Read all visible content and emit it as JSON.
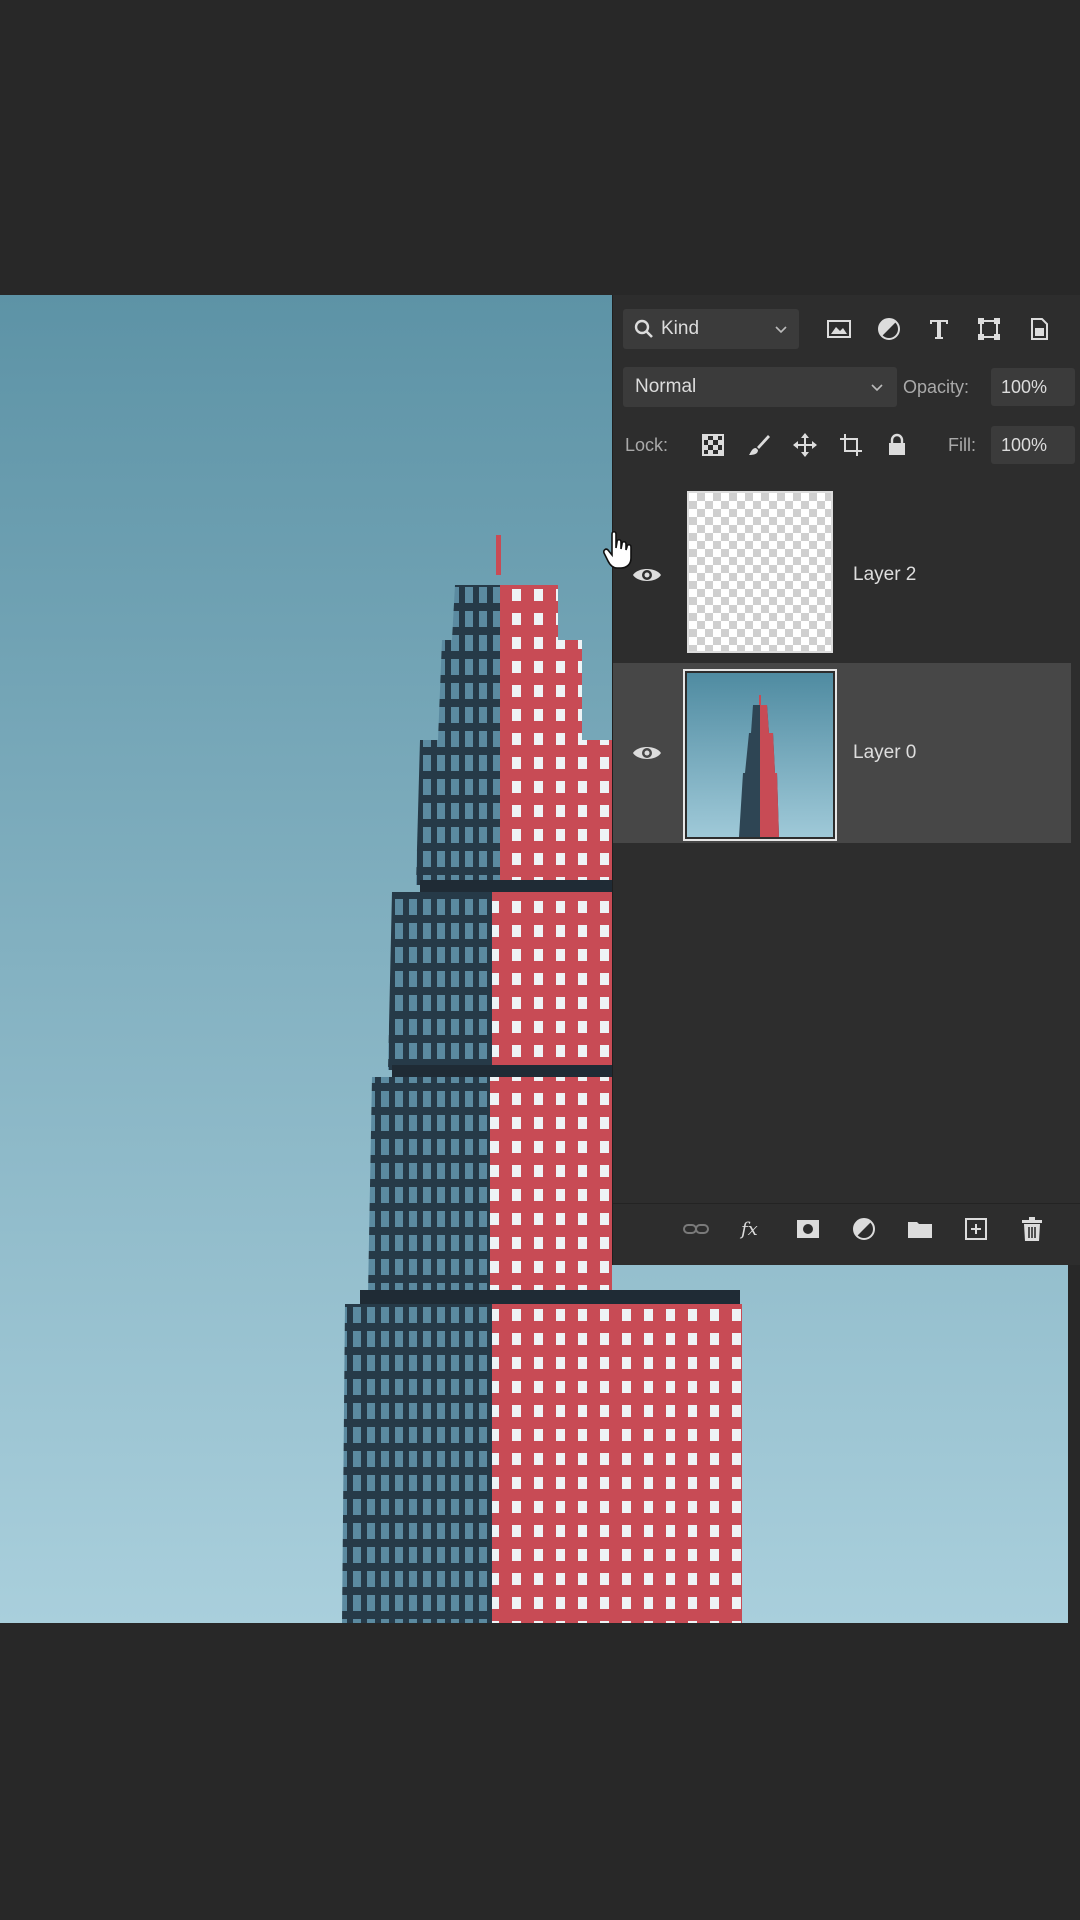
{
  "panel": {
    "filter": {
      "kind_label": "Kind",
      "icons": [
        "image-filter-icon",
        "adjustment-filter-icon",
        "type-filter-icon",
        "shape-filter-icon",
        "smart-object-filter-icon"
      ]
    },
    "blend": {
      "mode": "Normal",
      "opacity_label": "Opacity:",
      "opacity_value": "100%"
    },
    "lock": {
      "label": "Lock:",
      "fill_label": "Fill:",
      "fill_value": "100%",
      "icons": [
        "lock-transparent-pixels-icon",
        "lock-image-pixels-icon",
        "lock-position-icon",
        "lock-artboard-icon",
        "lock-all-icon"
      ]
    },
    "layers": [
      {
        "name": "Layer 2",
        "visible": true,
        "selected": false,
        "thumbnail": "transparent"
      },
      {
        "name": "Layer 0",
        "visible": true,
        "selected": true,
        "thumbnail": "building-photo"
      }
    ],
    "footer_icons": [
      "link-layers-icon",
      "fx-icon",
      "layer-mask-icon",
      "adjustment-layer-icon",
      "group-folder-icon",
      "new-layer-icon",
      "trash-icon"
    ]
  },
  "colors": {
    "sky_top": "#5d93a6",
    "sky_bottom": "#a9cfdc",
    "building_red": "#c84b55",
    "panel_bg": "#2d2d2d",
    "selected_row": "#474747"
  }
}
